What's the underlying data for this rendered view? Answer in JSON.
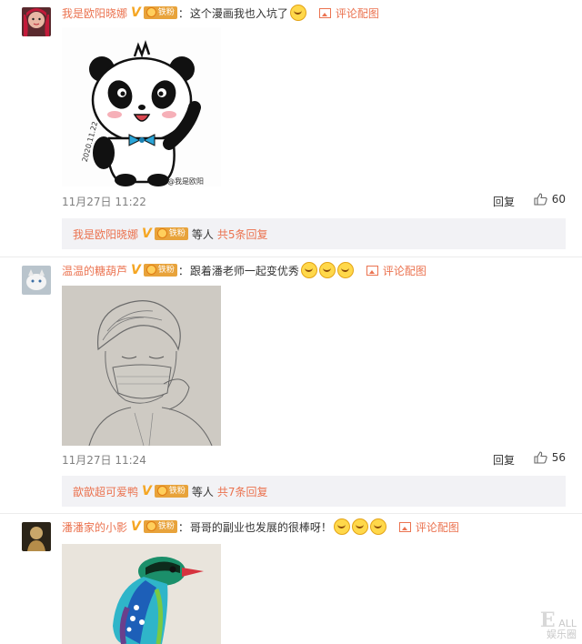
{
  "colors": {
    "accent": "#eb7350",
    "vip": "#f5a623",
    "meta": "#808080",
    "subbox": "#f2f2f5"
  },
  "comments": [
    {
      "username": "我是欧阳晓娜",
      "badge_label": "铁粉",
      "text": "这个漫画我也入坑了",
      "emoji_icons": [
        "grin-emoji"
      ],
      "pic_link": "评论配图",
      "image_caption": "@我是欧阳",
      "image_signature": "2020.11.22",
      "time": "11月27日 11:22",
      "reply_label": "回复",
      "likes": "60",
      "sub": {
        "name": "我是欧阳晓娜",
        "badge_label": "铁粉",
        "text": "等人",
        "count": "共5条回复"
      }
    },
    {
      "username": "温温的糖葫芦",
      "badge_label": "铁粉",
      "text": "跟着潘老师一起变优秀",
      "emoji_icons": [
        "kiss-emoji",
        "kiss-emoji",
        "kiss-emoji"
      ],
      "pic_link": "评论配图",
      "time": "11月27日 11:24",
      "reply_label": "回复",
      "likes": "56",
      "sub": {
        "name": "歆歆超可爱鸭",
        "badge_label": "铁粉",
        "text": "等人",
        "count": "共7条回复"
      }
    },
    {
      "username": "潘潘家的小影",
      "badge_label": "铁粉",
      "text": "哥哥的副业也发展的很棒呀！",
      "emoji_icons": [
        "laugh-cry-emoji",
        "laugh-cry-emoji",
        "laugh-cry-emoji"
      ],
      "pic_link": "评论配图"
    }
  ],
  "watermark": {
    "letter": "E",
    "line1": "ALL",
    "line2": "娱乐圈"
  }
}
